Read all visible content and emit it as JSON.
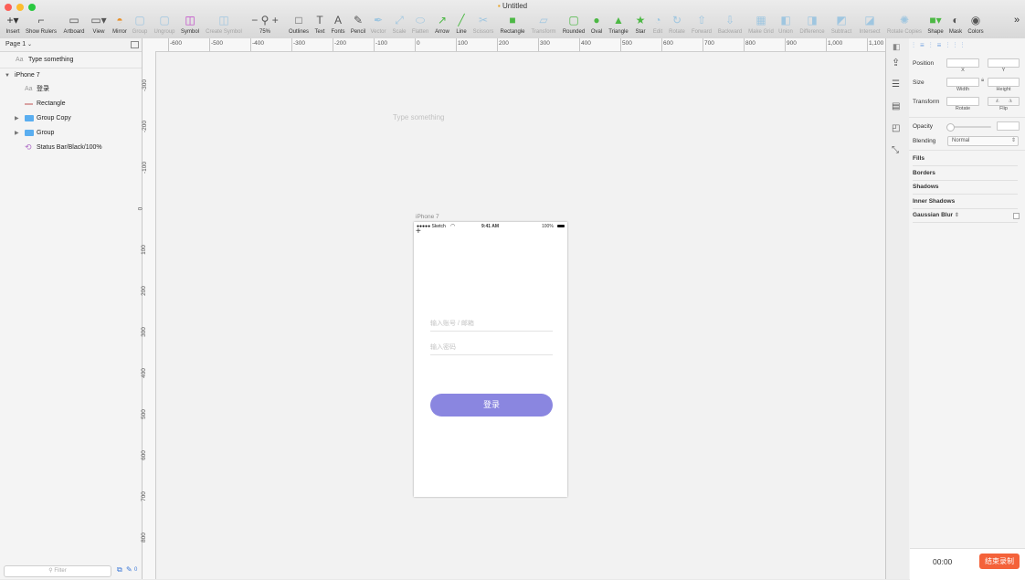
{
  "window": {
    "title": "Untitled"
  },
  "colors": {
    "accent": "#8a86e0",
    "record": "#f4623a",
    "folder": "#5aaef0",
    "toolbar_green": "#4cb844"
  },
  "toolbar": {
    "items": [
      {
        "label": "Insert",
        "icon": "insert-icon",
        "glyph": "+▾"
      },
      {
        "label": "Show Rulers",
        "icon": "rulers-icon",
        "glyph": "⌐"
      },
      {
        "label": "Artboard",
        "icon": "artboard-icon",
        "glyph": "▭"
      },
      {
        "label": "View",
        "icon": "view-icon",
        "glyph": "▭▾"
      },
      {
        "label": "Mirror",
        "icon": "mirror-icon",
        "glyph": "◓"
      },
      {
        "label": "Group",
        "icon": "group-icon",
        "glyph": "▢"
      },
      {
        "label": "Ungroup",
        "icon": "ungroup-icon",
        "glyph": "▢"
      },
      {
        "label": "Symbol",
        "icon": "symbol-icon",
        "glyph": "◫"
      },
      {
        "label": "Create Symbol",
        "icon": "create-symbol-icon",
        "glyph": "◫"
      },
      {
        "label": "75%",
        "icon": "zoom-icon",
        "glyph": "− ⚲ +"
      },
      {
        "label": "Outlines",
        "icon": "outlines-icon",
        "glyph": "□"
      },
      {
        "label": "Text",
        "icon": "text-icon",
        "glyph": "T"
      },
      {
        "label": "Fonts",
        "icon": "fonts-icon",
        "glyph": "A"
      },
      {
        "label": "Pencil",
        "icon": "pencil-icon",
        "glyph": "✎"
      },
      {
        "label": "Vector",
        "icon": "vector-icon",
        "glyph": "✒"
      },
      {
        "label": "Scale",
        "icon": "scale-icon",
        "glyph": "⤢"
      },
      {
        "label": "Flatten",
        "icon": "flatten-icon",
        "glyph": "⬭"
      },
      {
        "label": "Arrow",
        "icon": "arrow-icon",
        "glyph": "↗"
      },
      {
        "label": "Line",
        "icon": "line-icon",
        "glyph": "╱"
      },
      {
        "label": "Scissors",
        "icon": "scissors-icon",
        "glyph": "✂"
      },
      {
        "label": "Rectangle",
        "icon": "rectangle-icon",
        "glyph": "■"
      },
      {
        "label": "Transform",
        "icon": "transform-icon",
        "glyph": "▱"
      },
      {
        "label": "Rounded",
        "icon": "rounded-icon",
        "glyph": "▢"
      },
      {
        "label": "Oval",
        "icon": "oval-icon",
        "glyph": "●"
      },
      {
        "label": "Triangle",
        "icon": "triangle-icon",
        "glyph": "▲"
      },
      {
        "label": "Star",
        "icon": "star-icon",
        "glyph": "★"
      },
      {
        "label": "Edit",
        "icon": "edit-icon",
        "glyph": "◔"
      },
      {
        "label": "Rotate",
        "icon": "rotate-icon",
        "glyph": "↻"
      },
      {
        "label": "Forward",
        "icon": "forward-icon",
        "glyph": "⇧"
      },
      {
        "label": "Backward",
        "icon": "backward-icon",
        "glyph": "⇩"
      },
      {
        "label": "Make Grid",
        "icon": "grid-icon",
        "glyph": "▦"
      },
      {
        "label": "Union",
        "icon": "union-icon",
        "glyph": "◧"
      },
      {
        "label": "Difference",
        "icon": "difference-icon",
        "glyph": "◨"
      },
      {
        "label": "Subtract",
        "icon": "subtract-icon",
        "glyph": "◩"
      },
      {
        "label": "Intersect",
        "icon": "intersect-icon",
        "glyph": "◪"
      },
      {
        "label": "Rotate Copies",
        "icon": "rotate-copies-icon",
        "glyph": "✺"
      },
      {
        "label": "Shape",
        "icon": "shape-icon",
        "glyph": "■▾"
      },
      {
        "label": "Mask",
        "icon": "mask-icon",
        "glyph": "◐"
      },
      {
        "label": "Colors",
        "icon": "colors-icon",
        "glyph": "◉"
      }
    ],
    "more": "»"
  },
  "layers": {
    "page_selector": "Page 1",
    "rows": [
      {
        "label": "Type something",
        "kind": "text"
      },
      {
        "label": "iPhone 7",
        "kind": "artboard"
      },
      {
        "label": "登录",
        "kind": "text"
      },
      {
        "label": "Rectangle",
        "kind": "rect"
      },
      {
        "label": "Group Copy",
        "kind": "folder"
      },
      {
        "label": "Group",
        "kind": "folder"
      },
      {
        "label": "Status Bar/Black/100%",
        "kind": "symbol"
      }
    ],
    "filter_placeholder": "Filter",
    "footer_count": "0"
  },
  "rulers": {
    "h": [
      "-600",
      "-500",
      "-400",
      "-300",
      "-200",
      "-100",
      "0",
      "100",
      "200",
      "300",
      "400",
      "500",
      "600",
      "700",
      "800",
      "900",
      "1,000",
      "1,100"
    ],
    "v": [
      "-300",
      "-200",
      "-100",
      "0",
      "100",
      "200",
      "300",
      "400",
      "500",
      "600",
      "700",
      "800"
    ]
  },
  "canvas": {
    "floating_text": "Type something"
  },
  "artboard": {
    "name": "iPhone 7",
    "status_carrier": "●●●●● Sketch",
    "status_time": "9:41 AM",
    "status_battery": "100%",
    "account_placeholder": "输入账号 / 邮箱",
    "password_placeholder": "输入密码",
    "login_button": "登录"
  },
  "inspector": {
    "position_label": "Position",
    "x_label": "X",
    "y_label": "Y",
    "size_label": "Size",
    "width_label": "Width",
    "height_label": "Height",
    "transform_label": "Transform",
    "rotate_label": "Rotate",
    "flip_label": "Flip",
    "opacity_label": "Opacity",
    "blending_label": "Blending",
    "blending_value": "Normal",
    "sections": [
      "Fills",
      "Borders",
      "Shadows",
      "Inner Shadows",
      "Gaussian Blur"
    ]
  },
  "recording": {
    "time": "00:00",
    "stop_label": "结束录制"
  }
}
